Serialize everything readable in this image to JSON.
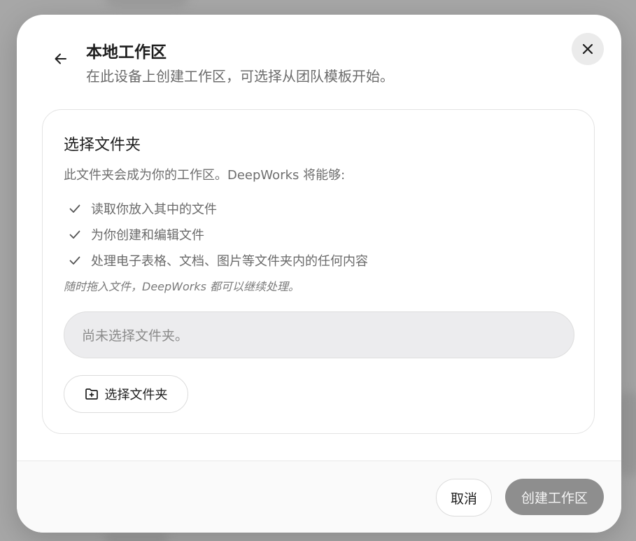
{
  "header": {
    "title": "本地工作区",
    "subtitle": "在此设备上创建工作区，可选择从团队模板开始。",
    "back_icon": "arrow-left-icon",
    "close_icon": "close-icon"
  },
  "card": {
    "title": "选择文件夹",
    "description": "此文件夹会成为你的工作区。DeepWorks 将能够:",
    "features": [
      {
        "label": "读取你放入其中的文件",
        "icon": "check-icon"
      },
      {
        "label": "为你创建和编辑文件",
        "icon": "check-icon"
      },
      {
        "label": "处理电子表格、文档、图片等文件夹内的任何内容",
        "icon": "check-icon"
      }
    ],
    "hint": "随时拖入文件，DeepWorks 都可以继续处理。",
    "path_placeholder": "尚未选择文件夹。",
    "choose_button_label": "选择文件夹",
    "choose_button_icon": "folder-plus-icon"
  },
  "footer": {
    "cancel_label": "取消",
    "create_label": "创建工作区",
    "create_disabled": true
  },
  "colors": {
    "backdrop": "#a7a7a7",
    "modal_background": "#ffffff",
    "disabled_button": "#8e8e8e",
    "muted_text": "#6b6b6b"
  }
}
